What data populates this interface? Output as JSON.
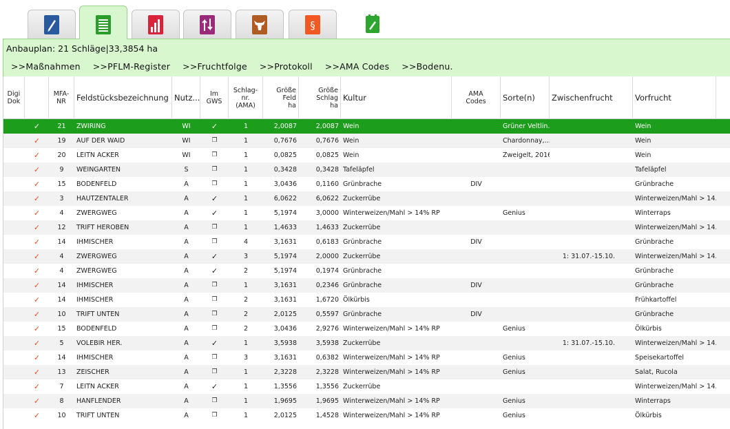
{
  "tabs": [
    {
      "name": "tab-notes",
      "icon": "pen-notebook-icon",
      "color": "#2a5a9e",
      "active": false
    },
    {
      "name": "tab-anbauplan",
      "icon": "clipboard-list-icon",
      "color": "#2a9d2a",
      "active": true
    },
    {
      "name": "tab-statistics",
      "icon": "bar-chart-icon",
      "color": "#d8233a",
      "active": false
    },
    {
      "name": "tab-transfer",
      "icon": "up-down-arrows-icon",
      "color": "#9a2a7a",
      "active": false
    },
    {
      "name": "tab-livestock",
      "icon": "cow-head-icon",
      "color": "#b05a24",
      "active": false
    },
    {
      "name": "tab-law",
      "icon": "paragraph-icon",
      "color": "#f05a22",
      "active": false
    },
    {
      "name": "tab-edit",
      "icon": "green-pencil-icon",
      "color": "#2ea52e",
      "active": false
    }
  ],
  "summary": "Anbauplan: 21 Schläge|33,3854 ha",
  "links": [
    ">>Maßnahmen",
    ">>PFLM-Register",
    ">>Fruchtfolge",
    ">>Protokoll",
    ">>AMA Codes",
    ">>Bodenu."
  ],
  "columns": {
    "digi": "Digi\nDok",
    "check": "",
    "mfa": "MFA-\nNR",
    "feld": "Feldstücksbezeichnung",
    "nutz": "Nutz...",
    "gws": "Im\nGWS",
    "schlag": "Schlag-\nnr.\n(AMA)",
    "gf": "Größe\nFeld\nha",
    "gs": "Größe\nSchlag\nha",
    "kultur": "Kultur",
    "ama": "AMA\nCodes",
    "sorte": "Sorte(n)",
    "zwisch": "Zwischenfrucht",
    "vorfr": "Vorfrucht"
  },
  "colors": {
    "selected_row": "#1c9d1c",
    "check": "#e8501e",
    "panel": "#d9f7cf"
  },
  "rows": [
    {
      "check": "✓",
      "mfa": "21",
      "feld": "ZWIRING",
      "nutz": "WI",
      "gws": "✓",
      "schlag": "1",
      "gf": "2,0087",
      "gs": "2,0087",
      "kultur": "Wein",
      "ama": "",
      "sorte": "Grüner Veltlin...",
      "zwisch": "",
      "vorfr": "Wein",
      "selected": true
    },
    {
      "check": "✓",
      "mfa": "19",
      "feld": "AUF DER WAID",
      "nutz": "WI",
      "gws": "❐",
      "schlag": "1",
      "gf": "0,7676",
      "gs": "0,7676",
      "kultur": "Wein",
      "ama": "",
      "sorte": "Chardonnay,...",
      "zwisch": "",
      "vorfr": "Wein"
    },
    {
      "check": "✓",
      "mfa": "20",
      "feld": "LEITN ACKER",
      "nutz": "WI",
      "gws": "❐",
      "schlag": "1",
      "gf": "0,0825",
      "gs": "0,0825",
      "kultur": "Wein",
      "ama": "",
      "sorte": "Zweigelt, 2016",
      "zwisch": "",
      "vorfr": "Wein"
    },
    {
      "check": "✓",
      "mfa": "9",
      "feld": "WEINGARTEN",
      "nutz": "S",
      "gws": "❐",
      "schlag": "1",
      "gf": "0,3428",
      "gs": "0,3428",
      "kultur": "Tafeläpfel",
      "ama": "",
      "sorte": "",
      "zwisch": "",
      "vorfr": "Tafeläpfel"
    },
    {
      "check": "✓",
      "mfa": "15",
      "feld": "BODENFELD",
      "nutz": "A",
      "gws": "❐",
      "schlag": "1",
      "gf": "3,0436",
      "gs": "0,1160",
      "kultur": "Grünbrache",
      "ama": "DIV",
      "sorte": "",
      "zwisch": "",
      "vorfr": "Grünbrache"
    },
    {
      "check": "✓",
      "mfa": "3",
      "feld": "HAUTZENTALER",
      "nutz": "A",
      "gws": "✓",
      "schlag": "1",
      "gf": "6,0622",
      "gs": "6,0622",
      "kultur": "Zuckerrübe",
      "ama": "",
      "sorte": "",
      "zwisch": "",
      "vorfr": "Winterweizen/Mahl > 14..."
    },
    {
      "check": "✓",
      "mfa": "4",
      "feld": "ZWERGWEG",
      "nutz": "A",
      "gws": "✓",
      "schlag": "1",
      "gf": "5,1974",
      "gs": "3,0000",
      "kultur": "Winterweizen/Mahl > 14% RP",
      "ama": "",
      "sorte": "Genius",
      "zwisch": "",
      "vorfr": "Winterraps"
    },
    {
      "check": "✓",
      "mfa": "12",
      "feld": "TRIFT HEROBEN",
      "nutz": "A",
      "gws": "❐",
      "schlag": "1",
      "gf": "1,4633",
      "gs": "1,4633",
      "kultur": "Zuckerrübe",
      "ama": "",
      "sorte": "",
      "zwisch": "",
      "vorfr": "Winterweizen/Mahl > 14..."
    },
    {
      "check": "✓",
      "mfa": "14",
      "feld": "IHMISCHER",
      "nutz": "A",
      "gws": "❐",
      "schlag": "4",
      "gf": "3,1631",
      "gs": "0,6183",
      "kultur": "Grünbrache",
      "ama": "DIV",
      "sorte": "",
      "zwisch": "",
      "vorfr": "Grünbrache"
    },
    {
      "check": "✓",
      "mfa": "4",
      "feld": "ZWERGWEG",
      "nutz": "A",
      "gws": "✓",
      "schlag": "3",
      "gf": "5,1974",
      "gs": "2,0000",
      "kultur": "Zuckerrübe",
      "ama": "",
      "sorte": "",
      "zwisch": "1: 31.07.-15.10.",
      "vorfr": "Winterweizen/Mahl > 14..."
    },
    {
      "check": "✓",
      "mfa": "4",
      "feld": "ZWERGWEG",
      "nutz": "A",
      "gws": "✓",
      "schlag": "2",
      "gf": "5,1974",
      "gs": "0,1974",
      "kultur": "Grünbrache",
      "ama": "",
      "sorte": "",
      "zwisch": "",
      "vorfr": "Grünbrache"
    },
    {
      "check": "✓",
      "mfa": "14",
      "feld": "IHMISCHER",
      "nutz": "A",
      "gws": "❐",
      "schlag": "1",
      "gf": "3,1631",
      "gs": "0,2346",
      "kultur": "Grünbrache",
      "ama": "DIV",
      "sorte": "",
      "zwisch": "",
      "vorfr": "Grünbrache"
    },
    {
      "check": "✓",
      "mfa": "14",
      "feld": "IHMISCHER",
      "nutz": "A",
      "gws": "❐",
      "schlag": "2",
      "gf": "3,1631",
      "gs": "1,6720",
      "kultur": "Ölkürbis",
      "ama": "",
      "sorte": "",
      "zwisch": "",
      "vorfr": "Frühkartoffel"
    },
    {
      "check": "✓",
      "mfa": "10",
      "feld": "TRIFT UNTEN",
      "nutz": "A",
      "gws": "❐",
      "schlag": "2",
      "gf": "2,0125",
      "gs": "0,5597",
      "kultur": "Grünbrache",
      "ama": "DIV",
      "sorte": "",
      "zwisch": "",
      "vorfr": "Grünbrache"
    },
    {
      "check": "✓",
      "mfa": "15",
      "feld": "BODENFELD",
      "nutz": "A",
      "gws": "❐",
      "schlag": "2",
      "gf": "3,0436",
      "gs": "2,9276",
      "kultur": "Winterweizen/Mahl > 14% RP",
      "ama": "",
      "sorte": "Genius",
      "zwisch": "",
      "vorfr": "Ölkürbis"
    },
    {
      "check": "✓",
      "mfa": "5",
      "feld": "VOLEBIR HER.",
      "nutz": "A",
      "gws": "✓",
      "schlag": "1",
      "gf": "3,5938",
      "gs": "3,5938",
      "kultur": "Zuckerrübe",
      "ama": "",
      "sorte": "",
      "zwisch": "1: 31.07.-15.10.",
      "vorfr": "Winterweizen/Mahl > 14..."
    },
    {
      "check": "✓",
      "mfa": "14",
      "feld": "IHMISCHER",
      "nutz": "A",
      "gws": "❐",
      "schlag": "3",
      "gf": "3,1631",
      "gs": "0,6382",
      "kultur": "Winterweizen/Mahl > 14% RP",
      "ama": "",
      "sorte": "Genius",
      "zwisch": "",
      "vorfr": "Speisekartoffel"
    },
    {
      "check": "✓",
      "mfa": "13",
      "feld": "ZEISCHER",
      "nutz": "A",
      "gws": "❐",
      "schlag": "1",
      "gf": "2,3228",
      "gs": "2,3228",
      "kultur": "Winterweizen/Mahl > 14% RP",
      "ama": "",
      "sorte": "Genius",
      "zwisch": "",
      "vorfr": "Salat, Rucola"
    },
    {
      "check": "✓",
      "mfa": "7",
      "feld": "LEITN ACKER",
      "nutz": "A",
      "gws": "✓",
      "schlag": "1",
      "gf": "1,3556",
      "gs": "1,3556",
      "kultur": "Zuckerrübe",
      "ama": "",
      "sorte": "",
      "zwisch": "",
      "vorfr": "Winterweizen/Mahl > 14..."
    },
    {
      "check": "✓",
      "mfa": "8",
      "feld": "HANFLENDER",
      "nutz": "A",
      "gws": "❐",
      "schlag": "1",
      "gf": "1,9695",
      "gs": "1,9695",
      "kultur": "Winterweizen/Mahl > 14% RP",
      "ama": "",
      "sorte": "Genius",
      "zwisch": "",
      "vorfr": "Winterraps"
    },
    {
      "check": "✓",
      "mfa": "10",
      "feld": "TRIFT UNTEN",
      "nutz": "A",
      "gws": "❐",
      "schlag": "1",
      "gf": "2,0125",
      "gs": "1,4528",
      "kultur": "Winterweizen/Mahl > 14% RP",
      "ama": "",
      "sorte": "Genius",
      "zwisch": "",
      "vorfr": "Ölkürbis"
    }
  ]
}
